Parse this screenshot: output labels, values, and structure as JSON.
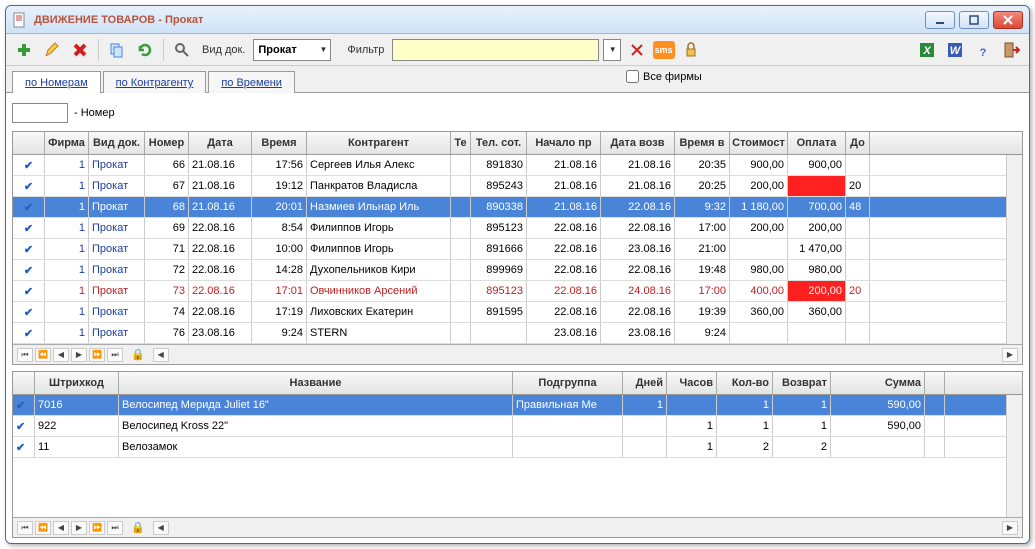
{
  "title": "ДВИЖЕНИЕ ТОВАРОВ - Прокат",
  "toolbar": {
    "doctype_label": "Вид док.",
    "doctype_value": "Прокат",
    "filter_label": "Фильтр"
  },
  "tabs": {
    "t1": "по Номерам",
    "t2": "по Контрагенту",
    "t3": "по Времени"
  },
  "allfirms": "Все фирмы",
  "numrow_label": "- Номер",
  "headers": {
    "firm": "Фирма",
    "doc": "Вид док.",
    "num": "Номер",
    "date": "Дата",
    "time": "Время",
    "agent": "Контрагент",
    "tel": "Те",
    "telcot": "Тел. сот.",
    "start": "Начало пр",
    "retd": "Дата возв",
    "rett": "Время в",
    "cost": "Стоимост",
    "pay": "Оплата",
    "ext": "До"
  },
  "rows": [
    {
      "firm": "1",
      "doc": "Прокат",
      "num": "66",
      "date": "21.08.16",
      "time": "17:56",
      "agent": "Сергеев Илья Алекс",
      "telcot": "891830",
      "start": "21.08.16",
      "retd": "21.08.16",
      "rett": "20:35",
      "cost": "900,00",
      "pay": "900,00",
      "ext": "",
      "sel": false,
      "red": false,
      "payred": false
    },
    {
      "firm": "1",
      "doc": "Прокат",
      "num": "67",
      "date": "21.08.16",
      "time": "19:12",
      "agent": "Панкратов Владисла",
      "telcot": "895243",
      "start": "21.08.16",
      "retd": "21.08.16",
      "rett": "20:25",
      "cost": "200,00",
      "pay": "",
      "ext": "20",
      "sel": false,
      "red": false,
      "payred": true
    },
    {
      "firm": "1",
      "doc": "Прокат",
      "num": "68",
      "date": "21.08.16",
      "time": "20:01",
      "agent": "Назмиев Ильнар Иль",
      "telcot": "890338",
      "start": "21.08.16",
      "retd": "22.08.16",
      "rett": "9:32",
      "cost": "1 180,00",
      "pay": "700,00",
      "ext": "48",
      "sel": true,
      "red": false,
      "payred": false
    },
    {
      "firm": "1",
      "doc": "Прокат",
      "num": "69",
      "date": "22.08.16",
      "time": "8:54",
      "agent": "Филиппов Игорь",
      "telcot": "895123",
      "start": "22.08.16",
      "retd": "22.08.16",
      "rett": "17:00",
      "cost": "200,00",
      "pay": "200,00",
      "ext": "",
      "sel": false,
      "red": false,
      "payred": false
    },
    {
      "firm": "1",
      "doc": "Прокат",
      "num": "71",
      "date": "22.08.16",
      "time": "10:00",
      "agent": "Филиппов Игорь",
      "telcot": "891666",
      "start": "22.08.16",
      "retd": "23.08.16",
      "rett": "21:00",
      "cost": "",
      "pay": "1 470,00",
      "ext": "",
      "sel": false,
      "red": false,
      "payred": false
    },
    {
      "firm": "1",
      "doc": "Прокат",
      "num": "72",
      "date": "22.08.16",
      "time": "14:28",
      "agent": "Духопельников Кири",
      "telcot": "899969",
      "start": "22.08.16",
      "retd": "22.08.16",
      "rett": "19:48",
      "cost": "980,00",
      "pay": "980,00",
      "ext": "",
      "sel": false,
      "red": false,
      "payred": false
    },
    {
      "firm": "1",
      "doc": "Прокат",
      "num": "73",
      "date": "22.08.16",
      "time": "17:01",
      "agent": "Овчинников Арсений",
      "telcot": "895123",
      "start": "22.08.16",
      "retd": "24.08.16",
      "rett": "17:00",
      "cost": "400,00",
      "pay": "200,00",
      "ext": "20",
      "sel": false,
      "red": true,
      "payred": true
    },
    {
      "firm": "1",
      "doc": "Прокат",
      "num": "74",
      "date": "22.08.16",
      "time": "17:19",
      "agent": "Лиховских Екатерин",
      "telcot": "891595",
      "start": "22.08.16",
      "retd": "22.08.16",
      "rett": "19:39",
      "cost": "360,00",
      "pay": "360,00",
      "ext": "",
      "sel": false,
      "red": false,
      "payred": false
    },
    {
      "firm": "1",
      "doc": "Прокат",
      "num": "76",
      "date": "23.08.16",
      "time": "9:24",
      "agent": "STERN",
      "telcot": "",
      "start": "23.08.16",
      "retd": "23.08.16",
      "rett": "9:24",
      "cost": "",
      "pay": "",
      "ext": "",
      "sel": false,
      "red": false,
      "payred": false
    }
  ],
  "headers2": {
    "bar": "Штрихкод",
    "name": "Название",
    "sub": "Подгруппа",
    "days": "Дней",
    "hours": "Часов",
    "qty": "Кол-во",
    "ret": "Возврат",
    "sum": "Сумма"
  },
  "details": [
    {
      "bar": "7016",
      "name": "Велосипед Мерида Juliet 16\"",
      "sub": "Правильная Ме",
      "days": "1",
      "hours": "",
      "qty": "1",
      "ret": "1",
      "sum": "590,00",
      "sel": true
    },
    {
      "bar": "922",
      "name": "Велосипед Kross 22\"",
      "sub": "",
      "days": "",
      "hours": "1",
      "qty": "1",
      "ret": "1",
      "sum": "590,00",
      "sel": false
    },
    {
      "bar": "11",
      "name": "Велозамок",
      "sub": "",
      "days": "",
      "hours": "1",
      "qty": "2",
      "ret": "2",
      "sum": "",
      "sel": false
    }
  ]
}
